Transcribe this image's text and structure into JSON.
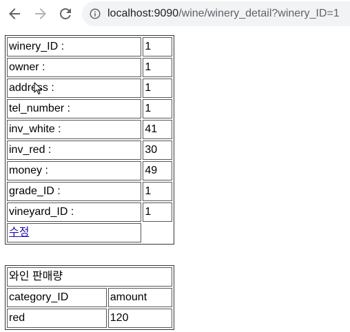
{
  "browser": {
    "url_host": "localhost:9090",
    "url_path": "/wine/winery_detail?winery_ID=1"
  },
  "winery_detail": {
    "rows": [
      {
        "label": "winery_ID :",
        "value": "1"
      },
      {
        "label": "owner :",
        "value": "1"
      },
      {
        "label": "address :",
        "value": "1"
      },
      {
        "label": "tel_number :",
        "value": "1"
      },
      {
        "label": "inv_white :",
        "value": "41"
      },
      {
        "label": "inv_red :",
        "value": "30"
      },
      {
        "label": "money :",
        "value": "49"
      },
      {
        "label": "grade_ID :",
        "value": "1"
      },
      {
        "label": "vineyard_ID :",
        "value": "1"
      }
    ],
    "edit_link": "수정"
  },
  "sales": {
    "title": "와인 판매량",
    "headers": [
      "category_ID",
      "amount"
    ],
    "rows": [
      [
        "red",
        "120"
      ]
    ]
  },
  "colors": {
    "link": "#1a0dab",
    "address_bar_bg": "#f1f3f4"
  },
  "icons": [
    "back-arrow-icon",
    "forward-arrow-icon",
    "reload-icon",
    "info-icon",
    "mouse-cursor-icon"
  ]
}
